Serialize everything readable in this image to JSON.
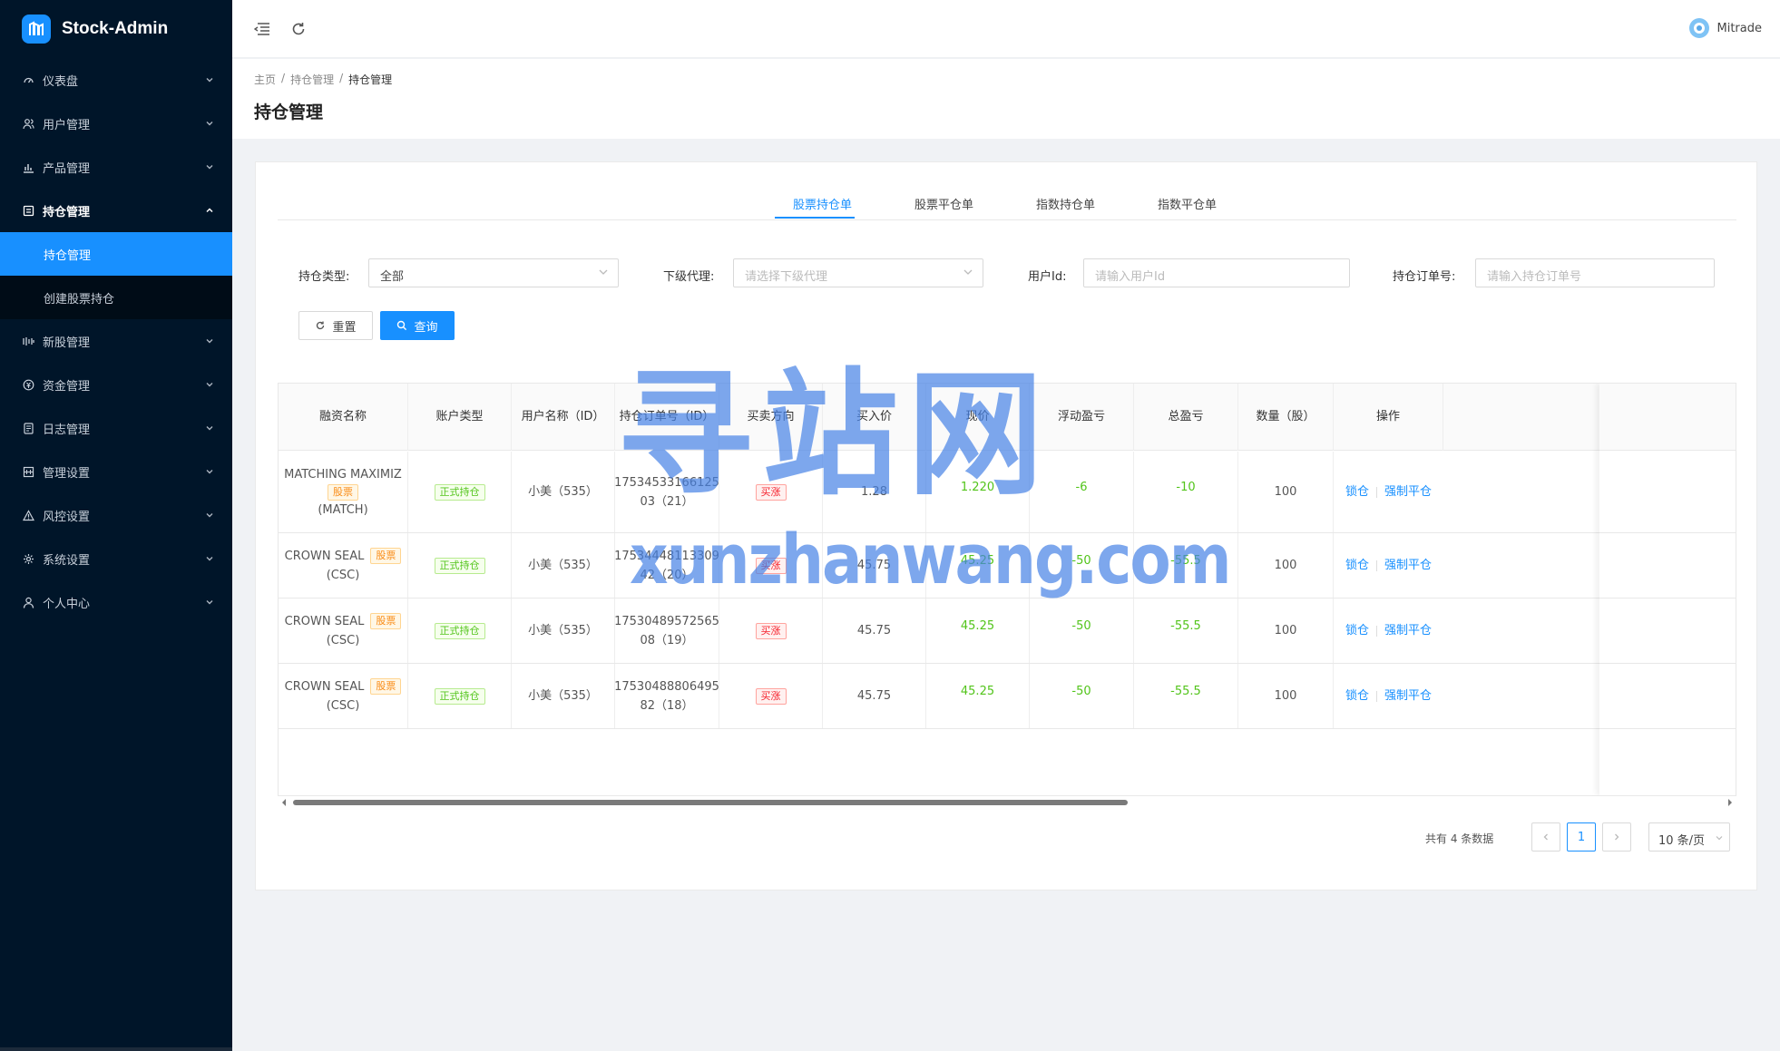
{
  "app": {
    "title": "Stock-Admin"
  },
  "sidebar": {
    "items": [
      {
        "label": "仪表盘",
        "icon": "dashboard-icon"
      },
      {
        "label": "用户管理",
        "icon": "users-icon"
      },
      {
        "label": "产品管理",
        "icon": "chart-icon"
      },
      {
        "label": "持仓管理",
        "icon": "position-icon"
      },
      {
        "label": "新股管理",
        "icon": "ipo-icon"
      },
      {
        "label": "资金管理",
        "icon": "money-icon"
      },
      {
        "label": "日志管理",
        "icon": "log-icon"
      },
      {
        "label": "管理设置",
        "icon": "admin-settings-icon"
      },
      {
        "label": "风控设置",
        "icon": "warning-icon"
      },
      {
        "label": "系统设置",
        "icon": "gear-icon"
      },
      {
        "label": "个人中心",
        "icon": "user-icon"
      }
    ],
    "sub_items": [
      {
        "label": "持仓管理",
        "active": true
      },
      {
        "label": "创建股票持仓",
        "active": false
      }
    ]
  },
  "header": {
    "user": "Mitrade"
  },
  "breadcrumb": [
    "主页",
    "持仓管理",
    "持仓管理"
  ],
  "breadcrumb_sep": "/",
  "page_title": "持仓管理",
  "tabs": [
    "股票持仓单",
    "股票平仓单",
    "指数持仓单",
    "指数平仓单"
  ],
  "filters": {
    "type_label": "持仓类型:",
    "type_value": "全部",
    "agent_label": "下级代理:",
    "agent_placeholder": "请选择下级代理",
    "userid_label": "用户Id:",
    "userid_placeholder": "请输入用户Id",
    "order_label": "持仓订单号:",
    "order_placeholder": "请输入持仓订单号"
  },
  "buttons": {
    "reset": "重置",
    "query": "查询"
  },
  "table": {
    "columns": [
      "融资名称",
      "账户类型",
      "用户名称（ID）",
      "持仓订单号（ID）",
      "买卖方向",
      "买入价",
      "现价",
      "浮动盈亏",
      "总盈亏",
      "数量（股）",
      "操作"
    ],
    "rows": [
      {
        "name": "MATCHING MAXIMIZ",
        "tag": "股票",
        "code": "(MATCH)",
        "account": "正式持仓",
        "user": "小美（535）",
        "order1": "17534533166125",
        "order2": "03（21）",
        "dir": "买涨",
        "buy": "1.28",
        "now": "1.220",
        "float": "-6",
        "total": "-10",
        "qty": "100",
        "lock": "锁仓",
        "force": "强制平仓"
      },
      {
        "name": "CROWN SEAL",
        "tag": "股票",
        "code": "(CSC)",
        "account": "正式持仓",
        "user": "小美（535）",
        "order1": "17534448113309",
        "order2": "42（20）",
        "dir": "买涨",
        "buy": "45.75",
        "now": "45.25",
        "float": "-50",
        "total": "-55.5",
        "qty": "100",
        "lock": "锁仓",
        "force": "强制平仓"
      },
      {
        "name": "CROWN SEAL",
        "tag": "股票",
        "code": "(CSC)",
        "account": "正式持仓",
        "user": "小美（535）",
        "order1": "17530489572565",
        "order2": "08（19）",
        "dir": "买涨",
        "buy": "45.75",
        "now": "45.25",
        "float": "-50",
        "total": "-55.5",
        "qty": "100",
        "lock": "锁仓",
        "force": "强制平仓"
      },
      {
        "name": "CROWN SEAL",
        "tag": "股票",
        "code": "(CSC)",
        "account": "正式持仓",
        "user": "小美（535）",
        "order1": "17530488806495",
        "order2": "82（18）",
        "dir": "买涨",
        "buy": "45.75",
        "now": "45.25",
        "float": "-50",
        "total": "-55.5",
        "qty": "100",
        "lock": "锁仓",
        "force": "强制平仓"
      }
    ]
  },
  "pagination": {
    "total_text": "共有 4 条数据",
    "current": "1",
    "page_size": "10 条/页"
  },
  "watermark": {
    "cn": "寻站网",
    "en": "xunzhanwang.com"
  },
  "colors": {
    "primary": "#1890ff",
    "sidebar": "#001529",
    "green": "#52c41a",
    "red": "#f5222d",
    "orange": "#fa8c16"
  }
}
